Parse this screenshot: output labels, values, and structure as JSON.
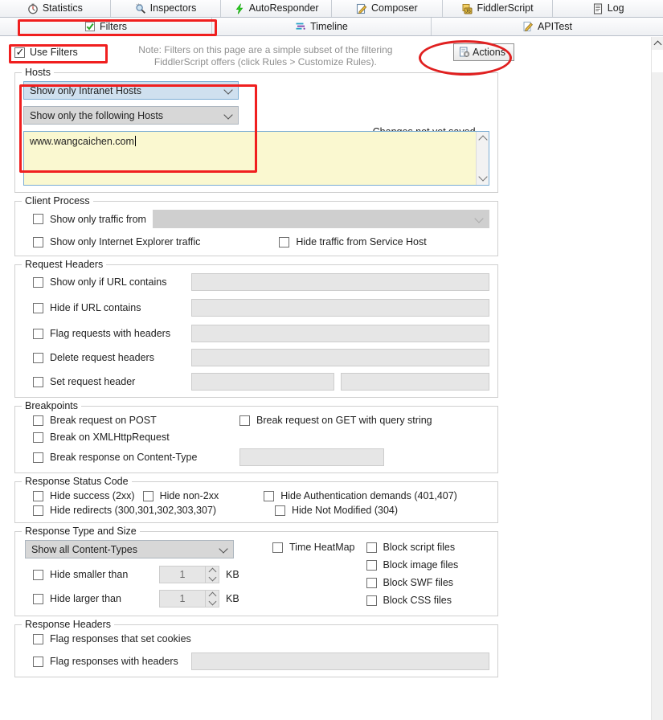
{
  "tabs_row1": [
    {
      "label": "Statistics",
      "icon": "clock-icon"
    },
    {
      "label": "Inspectors",
      "icon": "magnifier-icon"
    },
    {
      "label": "AutoResponder",
      "icon": "lightning-bolt-icon"
    },
    {
      "label": "Composer",
      "icon": "pencil-pad-icon"
    },
    {
      "label": "FiddlerScript",
      "icon": "script-js-icon"
    },
    {
      "label": "Log",
      "icon": "log-icon"
    }
  ],
  "tabs_row2": [
    {
      "label": "Filters",
      "icon": "green-check-icon"
    },
    {
      "label": "Timeline",
      "icon": "timeline-icon"
    },
    {
      "label": "APITest",
      "icon": "pencil-icon"
    }
  ],
  "toolbar": {
    "use_filters_label": "Use Filters",
    "use_filters_checked": true,
    "note_line1": "Note: Filters on this page are a simple subset of the filtering",
    "note_line2": "FiddlerScript offers (click Rules > Customize Rules).",
    "actions_label": "Actions",
    "actions_icon": "gear-document-icon"
  },
  "hosts": {
    "legend": "Hosts",
    "zone_combo_value": "Show only Intranet Hosts",
    "host_combo_value": "Show only the following Hosts",
    "hosts_textarea_value": "www.wangcaichen.com",
    "changes_note": "Changes not yet saved."
  },
  "client_process": {
    "legend": "Client Process",
    "show_only_traffic_from_label": "Show only traffic from",
    "process_combo_value": "",
    "show_only_ie_label": "Show only Internet Explorer traffic",
    "hide_service_host_label": "Hide traffic from Service Host"
  },
  "request_headers": {
    "legend": "Request Headers",
    "rows": [
      {
        "label": "Show only if URL contains",
        "value": ""
      },
      {
        "label": "Hide if URL contains",
        "value": ""
      },
      {
        "label": "Flag requests with headers",
        "value": ""
      },
      {
        "label": "Delete request headers",
        "value": ""
      }
    ],
    "set_request_header_label": "Set request header",
    "set_request_header_name": "",
    "set_request_header_value": ""
  },
  "breakpoints": {
    "legend": "Breakpoints",
    "break_post_label": "Break request on POST",
    "break_get_query_label": "Break request on GET with query string",
    "break_xhr_label": "Break on XMLHttpRequest",
    "break_response_ct_label": "Break response on Content-Type",
    "break_response_ct_value": ""
  },
  "response_status": {
    "legend": "Response Status Code",
    "hide_success_label": "Hide success (2xx)",
    "hide_non2xx_label": "Hide non-2xx",
    "hide_auth_label": "Hide Authentication demands (401,407)",
    "hide_redirects_label": "Hide redirects (300,301,302,303,307)",
    "hide_not_modified_label": "Hide Not Modified (304)"
  },
  "response_type_size": {
    "legend": "Response Type and Size",
    "content_type_combo_value": "Show all Content-Types",
    "hide_smaller_label": "Hide smaller than",
    "hide_smaller_value": "1",
    "hide_smaller_unit": "KB",
    "hide_larger_label": "Hide larger than",
    "hide_larger_value": "1",
    "hide_larger_unit": "KB",
    "time_heatmap_label": "Time HeatMap",
    "block_script_label": "Block script files",
    "block_image_label": "Block image files",
    "block_swf_label": "Block SWF files",
    "block_css_label": "Block CSS files"
  },
  "response_headers": {
    "legend": "Response Headers",
    "flag_cookies_label": "Flag responses that set cookies",
    "flag_headers_label": "Flag responses with headers",
    "flag_headers_value": ""
  },
  "colors": {
    "annotation_red": "#f01f1f",
    "hosts_field_yellow": "#faf8d0",
    "combo_focus_blue": "#cfe0ef",
    "tab_bg": "#eef1f5"
  }
}
